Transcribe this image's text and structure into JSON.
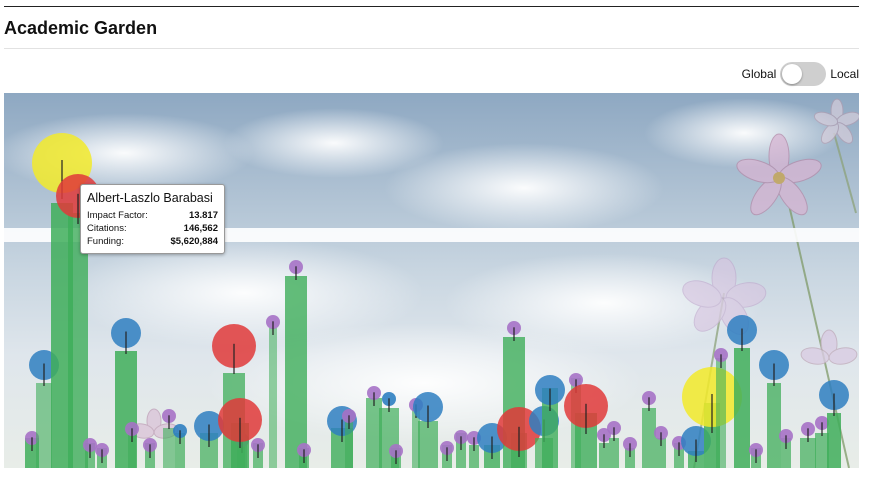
{
  "page": {
    "title": "Academic Garden"
  },
  "toggle": {
    "left_label": "Global",
    "right_label": "Local",
    "state": "Global"
  },
  "tooltip": {
    "name": "Albert-Laszlo Barabasi",
    "rows": [
      {
        "label": "Impact Factor:",
        "value": "13.817"
      },
      {
        "label": "Citations:",
        "value": "146,562"
      },
      {
        "label": "Funding:",
        "value": "$5,620,884"
      }
    ]
  },
  "colors": {
    "stem": "#3fae5a",
    "blue": "#2f7fc1",
    "red": "#e03a3a",
    "yellow": "#f2ea2a",
    "purple": "#a672c6"
  },
  "plants": [
    {
      "flower": "purple"
    },
    {
      "flower": "blue"
    },
    {
      "flower": "yellow"
    },
    {
      "flower": "red"
    },
    {
      "flower": "purple"
    },
    {
      "flower": "purple"
    },
    {
      "flower": "blue"
    },
    {
      "flower": "purple"
    },
    {
      "flower": "purple"
    },
    {
      "flower": "purple"
    },
    {
      "flower": "blue"
    },
    {
      "flower": "red"
    },
    {
      "flower": "red"
    },
    {
      "flower": "purple"
    },
    {
      "flower": "purple"
    },
    {
      "flower": "purple"
    },
    {
      "flower": "blue"
    },
    {
      "flower": "purple"
    },
    {
      "flower": "purple"
    },
    {
      "flower": "blue"
    },
    {
      "flower": "purple"
    },
    {
      "flower": "blue"
    },
    {
      "flower": "purple"
    },
    {
      "flower": "purple"
    },
    {
      "flower": "blue"
    },
    {
      "flower": "red"
    },
    {
      "flower": "purple"
    },
    {
      "flower": "blue"
    },
    {
      "flower": "blue"
    },
    {
      "flower": "red"
    },
    {
      "flower": "purple"
    },
    {
      "flower": "purple"
    },
    {
      "flower": "purple"
    },
    {
      "flower": "purple"
    },
    {
      "flower": "blue"
    },
    {
      "flower": "yellow"
    },
    {
      "flower": "blue"
    },
    {
      "flower": "purple"
    },
    {
      "flower": "blue"
    },
    {
      "flower": "blue"
    },
    {
      "flower": "purple"
    },
    {
      "flower": "blue"
    },
    {
      "flower": "purple"
    }
  ]
}
